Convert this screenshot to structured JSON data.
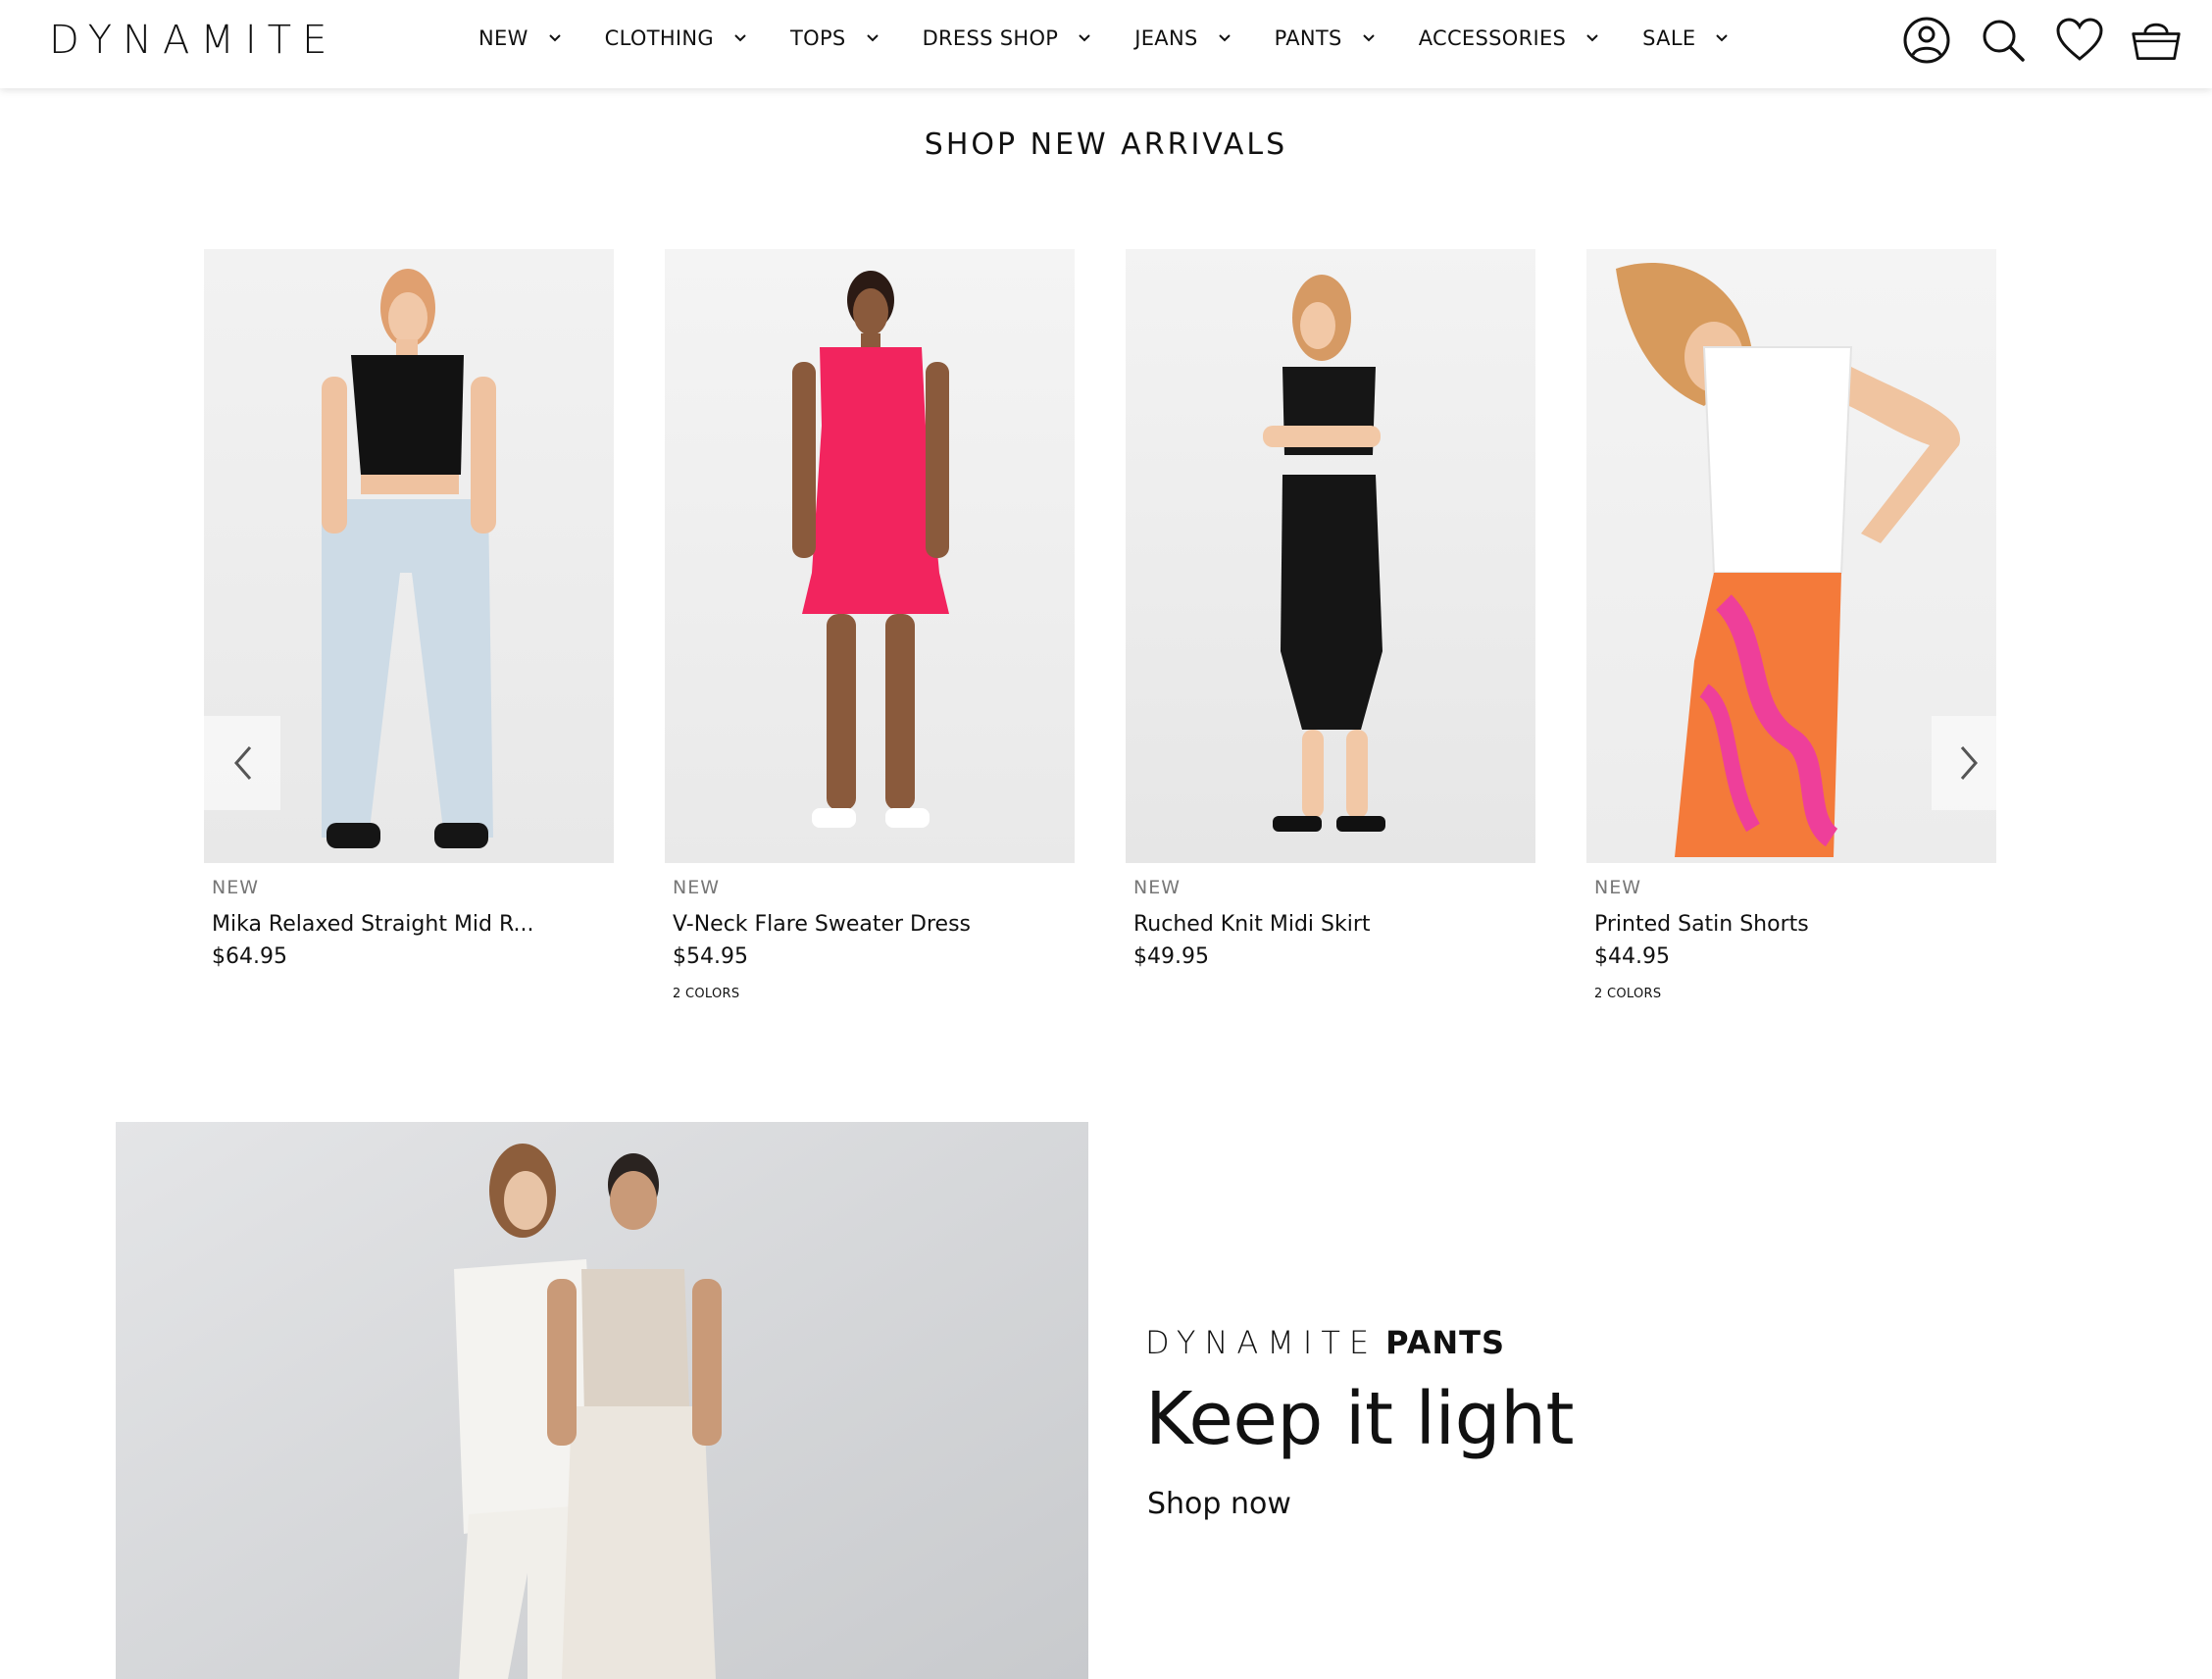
{
  "brand": {
    "logo": "DYNAMITE"
  },
  "nav": {
    "items": [
      {
        "label": "NEW"
      },
      {
        "label": "CLOTHING"
      },
      {
        "label": "TOPS"
      },
      {
        "label": "DRESS SHOP"
      },
      {
        "label": "JEANS"
      },
      {
        "label": "PANTS"
      },
      {
        "label": "ACCESSORIES"
      },
      {
        "label": "SALE"
      }
    ]
  },
  "header_icons": [
    "account-icon",
    "search-icon",
    "heart-icon",
    "cart-icon"
  ],
  "section": {
    "title": "SHOP NEW ARRIVALS"
  },
  "products": [
    {
      "badge": "NEW",
      "name": "Mika Relaxed Straight Mid R...",
      "price": "$64.95",
      "colors": ""
    },
    {
      "badge": "NEW",
      "name": "V-Neck Flare Sweater Dress",
      "price": "$54.95",
      "colors": "2 COLORS"
    },
    {
      "badge": "NEW",
      "name": "Ruched Knit Midi Skirt",
      "price": "$49.95",
      "colors": ""
    },
    {
      "badge": "NEW",
      "name": "Printed Satin Shorts",
      "price": "$44.95",
      "colors": "2 COLORS"
    }
  ],
  "promo": {
    "brand_word": "DYNAMITE",
    "category_word": "PANTS",
    "headline": "Keep it light",
    "cta": "Shop now"
  },
  "colors": {
    "accent_pink": "#f2245e",
    "shorts_orange": "#f47a3a",
    "text": "#111111",
    "muted": "#777777"
  }
}
